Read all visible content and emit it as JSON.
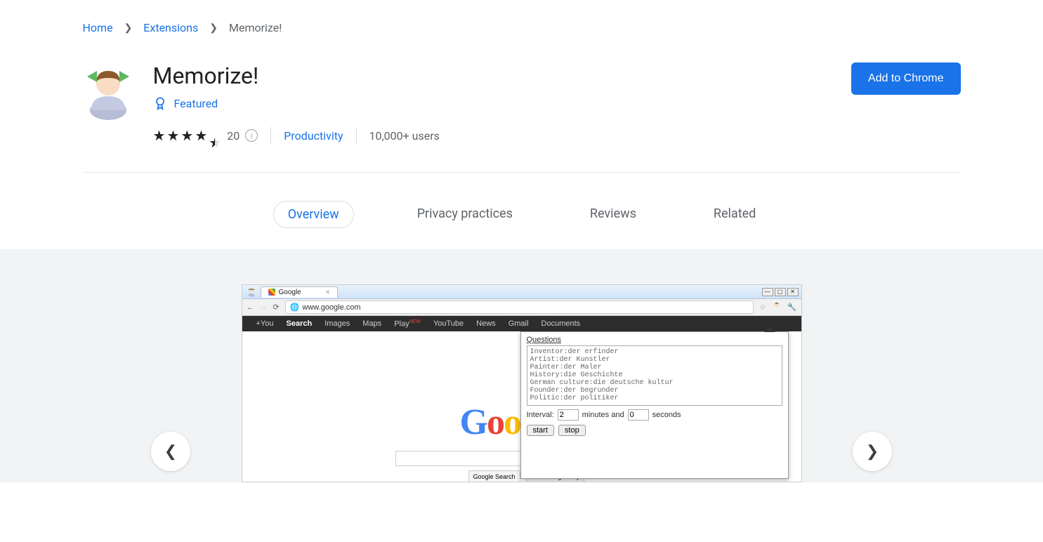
{
  "breadcrumb": {
    "home": "Home",
    "extensions": "Extensions",
    "current": "Memorize!"
  },
  "header": {
    "title": "Memorize!",
    "featured": "Featured",
    "rating_count": "20",
    "category": "Productivity",
    "users": "10,000+ users",
    "add_button": "Add to Chrome"
  },
  "tabs": {
    "overview": "Overview",
    "privacy": "Privacy practices",
    "reviews": "Reviews",
    "related": "Related"
  },
  "screenshot": {
    "tab_title": "Google",
    "url": "www.google.com",
    "blackbar": {
      "you": "+You",
      "search": "Search",
      "images": "Images",
      "maps": "Maps",
      "play": "Play",
      "play_new": "NEW",
      "youtube": "YouTube",
      "news": "News",
      "gmail": "Gmail",
      "documents": "Documents"
    },
    "google_search": "Google Search",
    "feeling_lucky": "I'm Feeling Lucky",
    "popup": {
      "title": "Questions",
      "content": "Inventor:der erfinder\nArtist:der Kunstler\nPainter:der Maler\nHistory:die Geschichte\nGerman culture:die deutsche kultur\nFounder:der begrunder\nPolitic:der politiker",
      "interval_label": "Interval:",
      "minutes_val": "2",
      "minutes_and": "minutes and",
      "seconds_val": "0",
      "seconds_label": "seconds",
      "start": "start",
      "stop": "stop"
    }
  }
}
